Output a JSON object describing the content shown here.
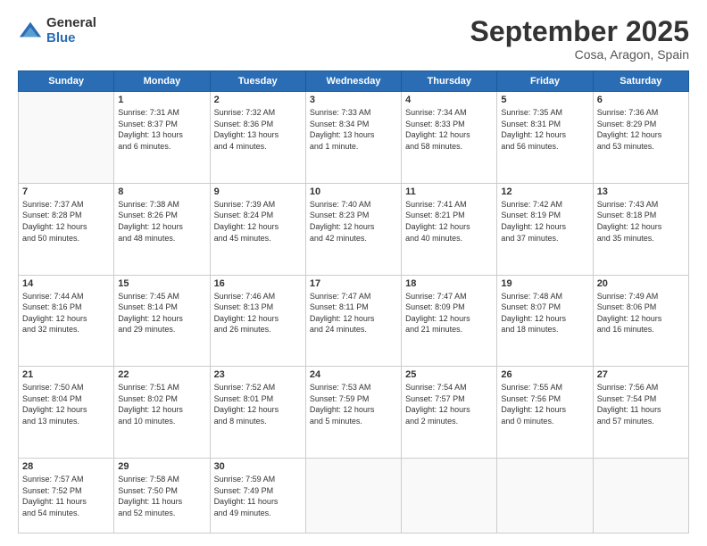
{
  "logo": {
    "general": "General",
    "blue": "Blue"
  },
  "header": {
    "month": "September 2025",
    "location": "Cosa, Aragon, Spain"
  },
  "weekdays": [
    "Sunday",
    "Monday",
    "Tuesday",
    "Wednesday",
    "Thursday",
    "Friday",
    "Saturday"
  ],
  "weeks": [
    [
      {
        "day": "",
        "info": ""
      },
      {
        "day": "1",
        "info": "Sunrise: 7:31 AM\nSunset: 8:37 PM\nDaylight: 13 hours\nand 6 minutes."
      },
      {
        "day": "2",
        "info": "Sunrise: 7:32 AM\nSunset: 8:36 PM\nDaylight: 13 hours\nand 4 minutes."
      },
      {
        "day": "3",
        "info": "Sunrise: 7:33 AM\nSunset: 8:34 PM\nDaylight: 13 hours\nand 1 minute."
      },
      {
        "day": "4",
        "info": "Sunrise: 7:34 AM\nSunset: 8:33 PM\nDaylight: 12 hours\nand 58 minutes."
      },
      {
        "day": "5",
        "info": "Sunrise: 7:35 AM\nSunset: 8:31 PM\nDaylight: 12 hours\nand 56 minutes."
      },
      {
        "day": "6",
        "info": "Sunrise: 7:36 AM\nSunset: 8:29 PM\nDaylight: 12 hours\nand 53 minutes."
      }
    ],
    [
      {
        "day": "7",
        "info": "Sunrise: 7:37 AM\nSunset: 8:28 PM\nDaylight: 12 hours\nand 50 minutes."
      },
      {
        "day": "8",
        "info": "Sunrise: 7:38 AM\nSunset: 8:26 PM\nDaylight: 12 hours\nand 48 minutes."
      },
      {
        "day": "9",
        "info": "Sunrise: 7:39 AM\nSunset: 8:24 PM\nDaylight: 12 hours\nand 45 minutes."
      },
      {
        "day": "10",
        "info": "Sunrise: 7:40 AM\nSunset: 8:23 PM\nDaylight: 12 hours\nand 42 minutes."
      },
      {
        "day": "11",
        "info": "Sunrise: 7:41 AM\nSunset: 8:21 PM\nDaylight: 12 hours\nand 40 minutes."
      },
      {
        "day": "12",
        "info": "Sunrise: 7:42 AM\nSunset: 8:19 PM\nDaylight: 12 hours\nand 37 minutes."
      },
      {
        "day": "13",
        "info": "Sunrise: 7:43 AM\nSunset: 8:18 PM\nDaylight: 12 hours\nand 35 minutes."
      }
    ],
    [
      {
        "day": "14",
        "info": "Sunrise: 7:44 AM\nSunset: 8:16 PM\nDaylight: 12 hours\nand 32 minutes."
      },
      {
        "day": "15",
        "info": "Sunrise: 7:45 AM\nSunset: 8:14 PM\nDaylight: 12 hours\nand 29 minutes."
      },
      {
        "day": "16",
        "info": "Sunrise: 7:46 AM\nSunset: 8:13 PM\nDaylight: 12 hours\nand 26 minutes."
      },
      {
        "day": "17",
        "info": "Sunrise: 7:47 AM\nSunset: 8:11 PM\nDaylight: 12 hours\nand 24 minutes."
      },
      {
        "day": "18",
        "info": "Sunrise: 7:47 AM\nSunset: 8:09 PM\nDaylight: 12 hours\nand 21 minutes."
      },
      {
        "day": "19",
        "info": "Sunrise: 7:48 AM\nSunset: 8:07 PM\nDaylight: 12 hours\nand 18 minutes."
      },
      {
        "day": "20",
        "info": "Sunrise: 7:49 AM\nSunset: 8:06 PM\nDaylight: 12 hours\nand 16 minutes."
      }
    ],
    [
      {
        "day": "21",
        "info": "Sunrise: 7:50 AM\nSunset: 8:04 PM\nDaylight: 12 hours\nand 13 minutes."
      },
      {
        "day": "22",
        "info": "Sunrise: 7:51 AM\nSunset: 8:02 PM\nDaylight: 12 hours\nand 10 minutes."
      },
      {
        "day": "23",
        "info": "Sunrise: 7:52 AM\nSunset: 8:01 PM\nDaylight: 12 hours\nand 8 minutes."
      },
      {
        "day": "24",
        "info": "Sunrise: 7:53 AM\nSunset: 7:59 PM\nDaylight: 12 hours\nand 5 minutes."
      },
      {
        "day": "25",
        "info": "Sunrise: 7:54 AM\nSunset: 7:57 PM\nDaylight: 12 hours\nand 2 minutes."
      },
      {
        "day": "26",
        "info": "Sunrise: 7:55 AM\nSunset: 7:56 PM\nDaylight: 12 hours\nand 0 minutes."
      },
      {
        "day": "27",
        "info": "Sunrise: 7:56 AM\nSunset: 7:54 PM\nDaylight: 11 hours\nand 57 minutes."
      }
    ],
    [
      {
        "day": "28",
        "info": "Sunrise: 7:57 AM\nSunset: 7:52 PM\nDaylight: 11 hours\nand 54 minutes."
      },
      {
        "day": "29",
        "info": "Sunrise: 7:58 AM\nSunset: 7:50 PM\nDaylight: 11 hours\nand 52 minutes."
      },
      {
        "day": "30",
        "info": "Sunrise: 7:59 AM\nSunset: 7:49 PM\nDaylight: 11 hours\nand 49 minutes."
      },
      {
        "day": "",
        "info": ""
      },
      {
        "day": "",
        "info": ""
      },
      {
        "day": "",
        "info": ""
      },
      {
        "day": "",
        "info": ""
      }
    ]
  ]
}
